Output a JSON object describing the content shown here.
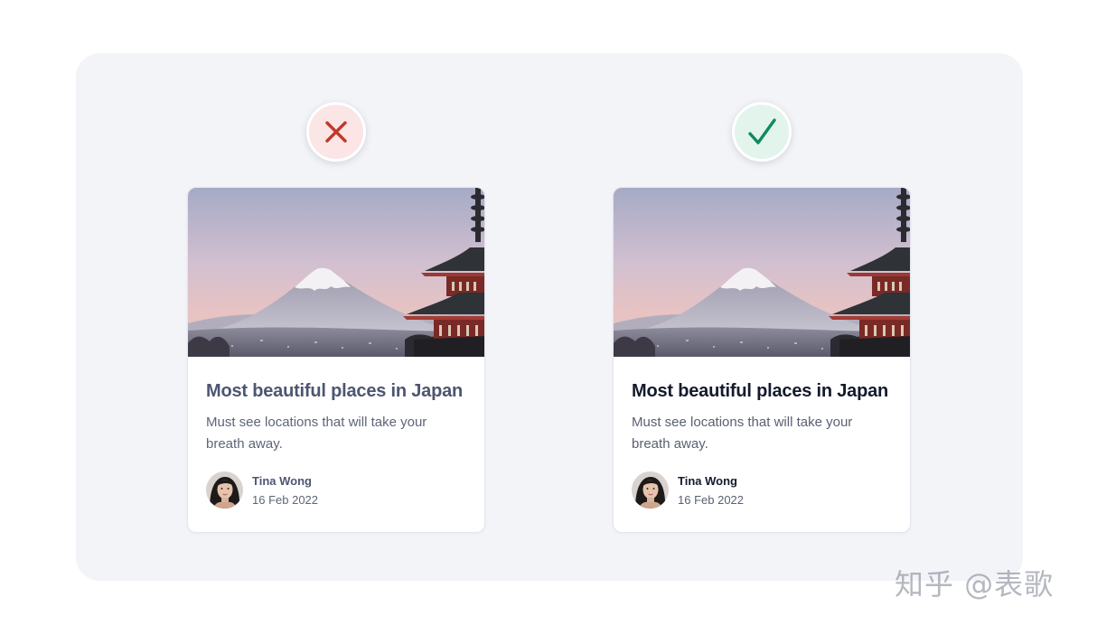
{
  "comparison": {
    "bad_badge": {
      "icon": "x-mark-icon",
      "color": "#c0392b",
      "background": "#fbe5e5"
    },
    "good_badge": {
      "icon": "check-mark-icon",
      "color": "#0f8a5f",
      "background": "#e3f4ec"
    },
    "cards": [
      {
        "variant": "incorrect",
        "title": "Most beautiful places in Japan",
        "description": "Must see locations that will take your breath away.",
        "author": "Tina Wong",
        "date": "16 Feb 2022",
        "title_color": "#4d5670"
      },
      {
        "variant": "correct",
        "title": "Most beautiful places in Japan",
        "description": "Must see locations that will take your breath away.",
        "author": "Tina Wong",
        "date": "16 Feb 2022",
        "title_color": "#141a2c"
      }
    ]
  },
  "watermark": "知乎 @表歌"
}
